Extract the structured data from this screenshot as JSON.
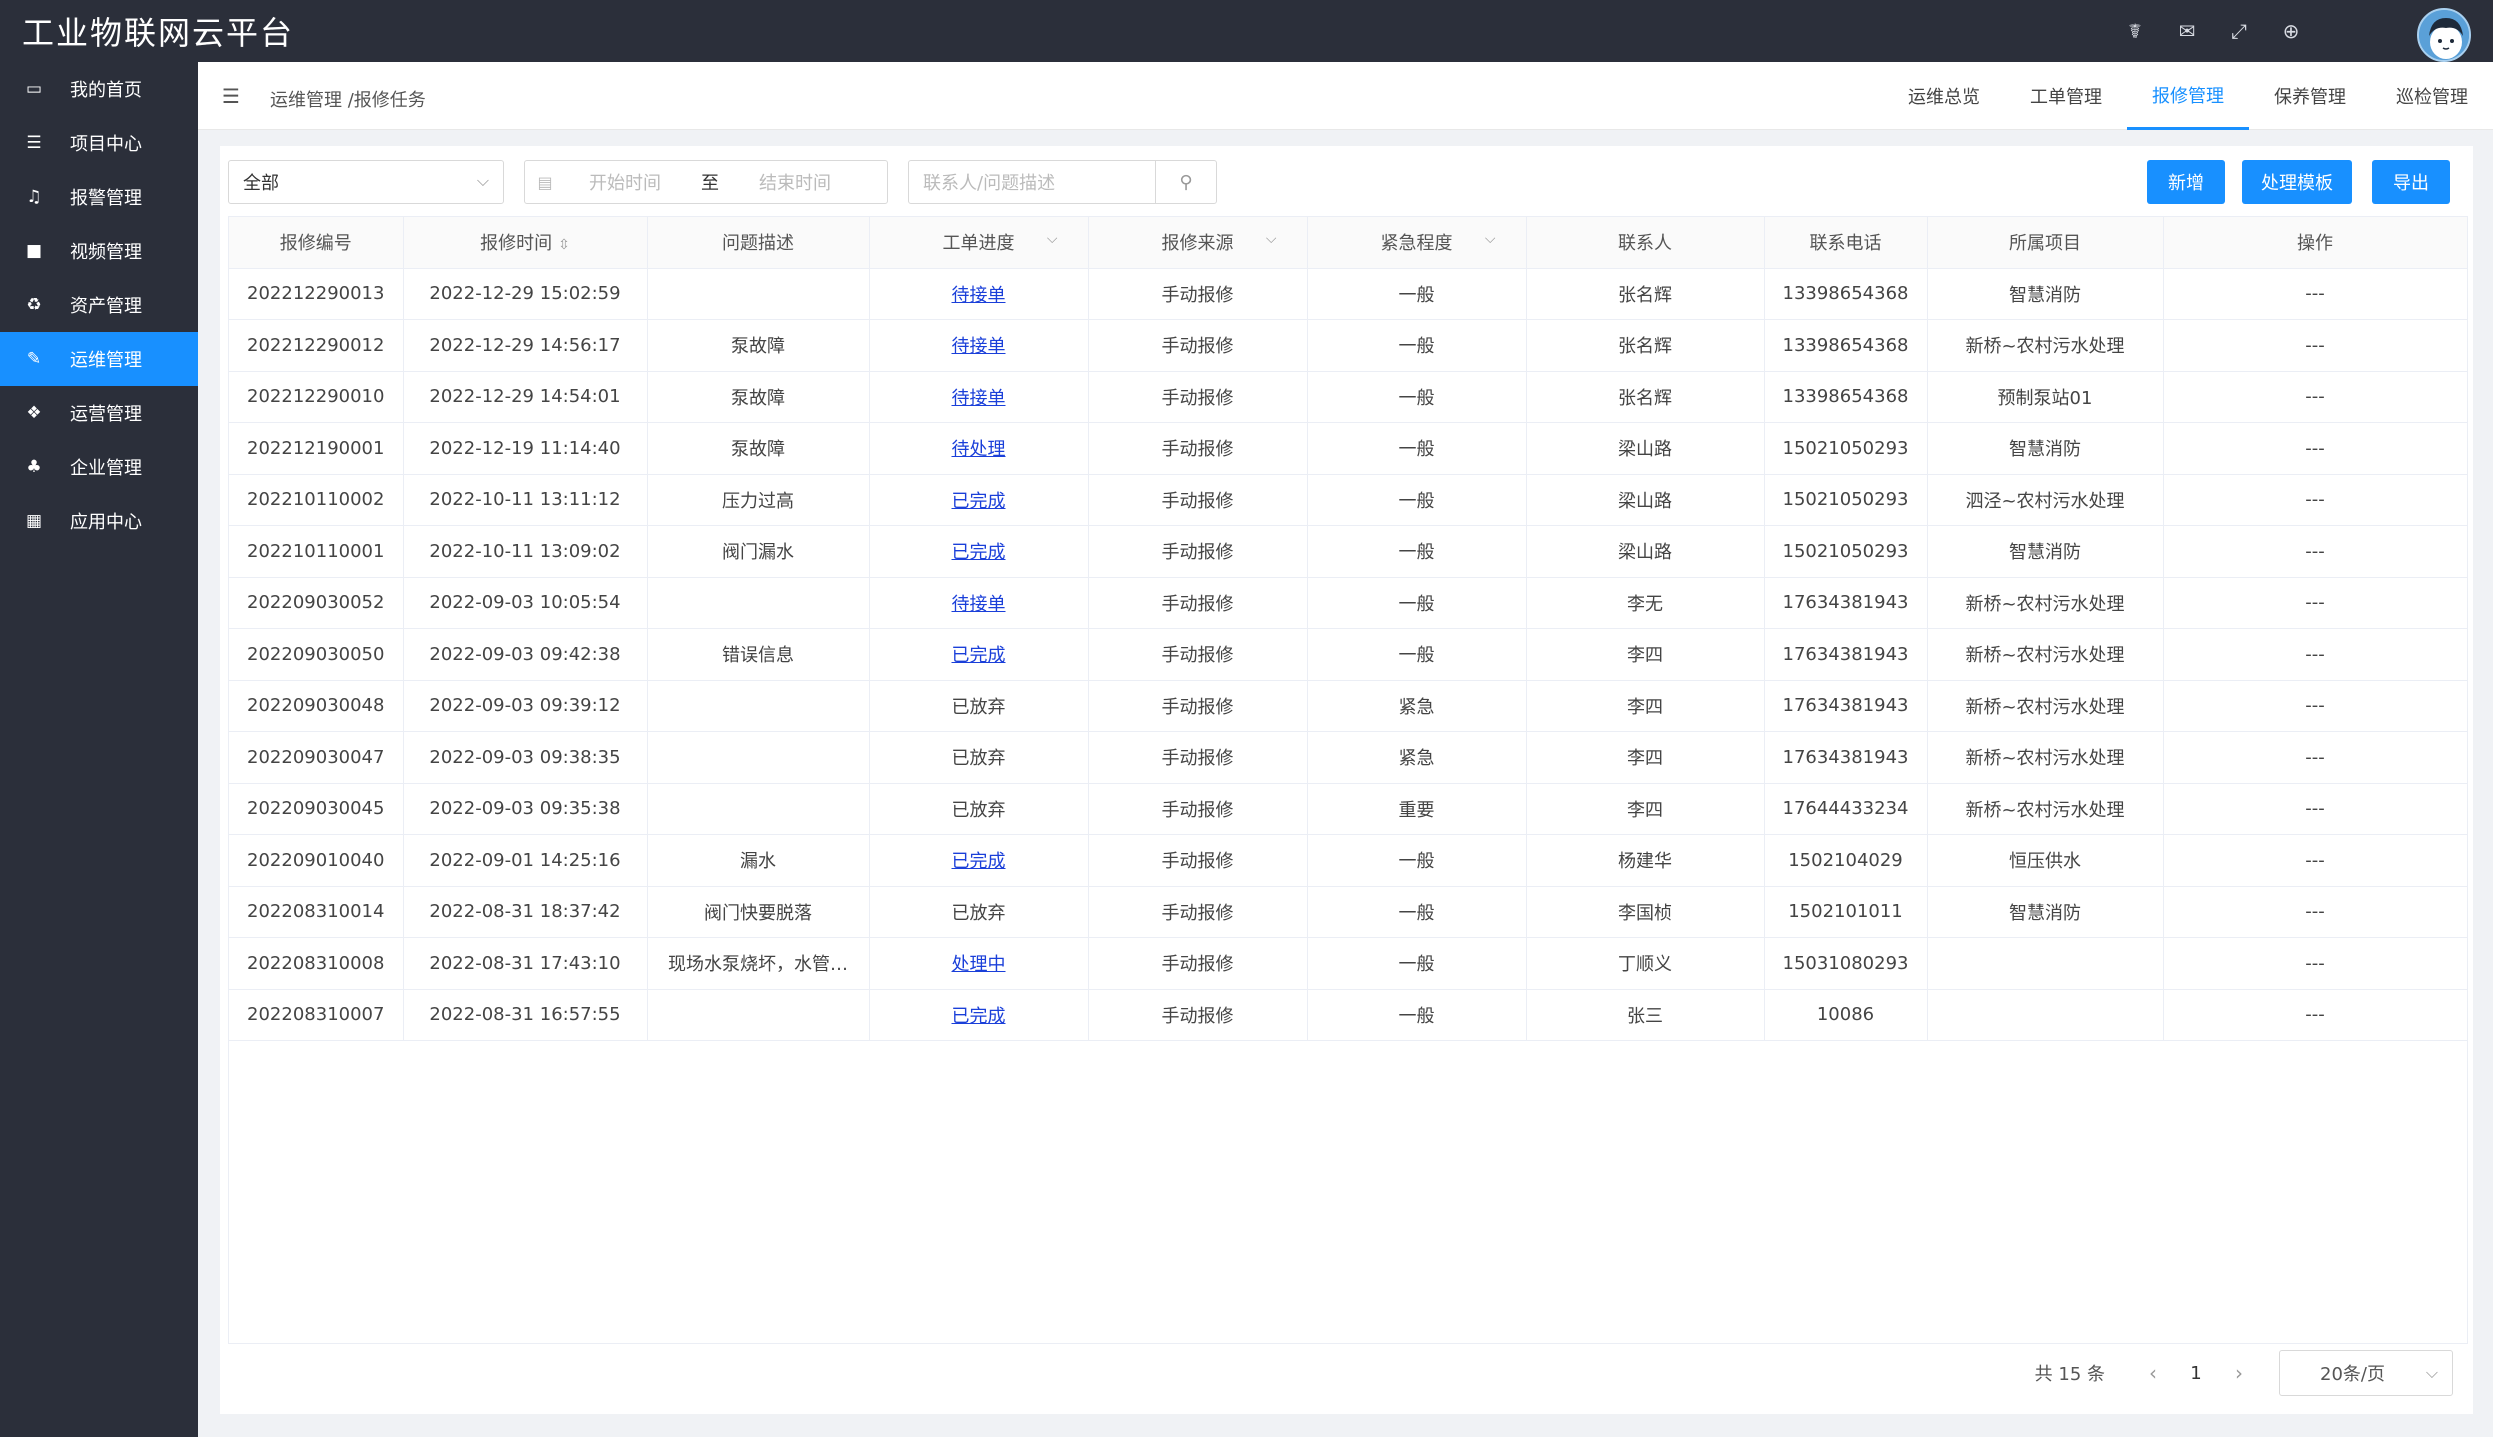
{
  "app": {
    "title": "工业物联网云平台",
    "header_icons": [
      "bug-icon",
      "mail-icon",
      "fullscreen-icon",
      "globe-icon"
    ]
  },
  "sidebar": {
    "items": [
      {
        "label": "我的首页",
        "icon": "laptop-icon",
        "active": false
      },
      {
        "label": "项目中心",
        "icon": "list-icon",
        "active": false
      },
      {
        "label": "报警管理",
        "icon": "bell-icon",
        "active": false
      },
      {
        "label": "视频管理",
        "icon": "video-icon",
        "active": false
      },
      {
        "label": "资产管理",
        "icon": "recycle-icon",
        "active": false
      },
      {
        "label": "运维管理",
        "icon": "wrench-icon",
        "active": true
      },
      {
        "label": "运营管理",
        "icon": "cubes-icon",
        "active": false
      },
      {
        "label": "企业管理",
        "icon": "sitemap-icon",
        "active": false
      },
      {
        "label": "应用中心",
        "icon": "grid-icon",
        "active": false
      }
    ]
  },
  "breadcrumb": "运维管理 /报修任务",
  "tabs": [
    {
      "label": "运维总览",
      "active": false
    },
    {
      "label": "工单管理",
      "active": false
    },
    {
      "label": "报修管理",
      "active": true
    },
    {
      "label": "保养管理",
      "active": false
    },
    {
      "label": "巡检管理",
      "active": false
    }
  ],
  "filters": {
    "status_select": "全部",
    "start_placeholder": "开始时间",
    "range_separator": "至",
    "end_placeholder": "结束时间",
    "search_placeholder": "联系人/问题描述"
  },
  "actions": {
    "add": "新增",
    "template": "处理模板",
    "export": "导出"
  },
  "table": {
    "headers": [
      "报修编号",
      "报修时间",
      "问题描述",
      "工单进度",
      "报修来源",
      "紧急程度",
      "联系人",
      "联系电话",
      "所属项目",
      "操作"
    ],
    "rows": [
      {
        "id": "202212290013",
        "time": "2022-12-29 15:02:59",
        "desc": "",
        "progress": "待接单",
        "link": true,
        "source": "手动报修",
        "urgency": "一般",
        "contact": "张名辉",
        "phone": "13398654368",
        "project": "智慧消防",
        "op": "---"
      },
      {
        "id": "202212290012",
        "time": "2022-12-29 14:56:17",
        "desc": "泵故障",
        "progress": "待接单",
        "link": true,
        "source": "手动报修",
        "urgency": "一般",
        "contact": "张名辉",
        "phone": "13398654368",
        "project": "新桥~农村污水处理",
        "op": "---"
      },
      {
        "id": "202212290010",
        "time": "2022-12-29 14:54:01",
        "desc": "泵故障",
        "progress": "待接单",
        "link": true,
        "source": "手动报修",
        "urgency": "一般",
        "contact": "张名辉",
        "phone": "13398654368",
        "project": "预制泵站01",
        "op": "---"
      },
      {
        "id": "202212190001",
        "time": "2022-12-19 11:14:40",
        "desc": "泵故障",
        "progress": "待处理",
        "link": true,
        "source": "手动报修",
        "urgency": "一般",
        "contact": "梁山路",
        "phone": "15021050293",
        "project": "智慧消防",
        "op": "---"
      },
      {
        "id": "202210110002",
        "time": "2022-10-11 13:11:12",
        "desc": "压力过高",
        "progress": "已完成",
        "link": true,
        "source": "手动报修",
        "urgency": "一般",
        "contact": "梁山路",
        "phone": "15021050293",
        "project": "泗泾~农村污水处理",
        "op": "---"
      },
      {
        "id": "202210110001",
        "time": "2022-10-11 13:09:02",
        "desc": "阀门漏水",
        "progress": "已完成",
        "link": true,
        "source": "手动报修",
        "urgency": "一般",
        "contact": "梁山路",
        "phone": "15021050293",
        "project": "智慧消防",
        "op": "---"
      },
      {
        "id": "202209030052",
        "time": "2022-09-03 10:05:54",
        "desc": "",
        "progress": "待接单",
        "link": true,
        "source": "手动报修",
        "urgency": "一般",
        "contact": "李无",
        "phone": "17634381943",
        "project": "新桥~农村污水处理",
        "op": "---"
      },
      {
        "id": "202209030050",
        "time": "2022-09-03 09:42:38",
        "desc": "错误信息",
        "progress": "已完成",
        "link": true,
        "source": "手动报修",
        "urgency": "一般",
        "contact": "李四",
        "phone": "17634381943",
        "project": "新桥~农村污水处理",
        "op": "---"
      },
      {
        "id": "202209030048",
        "time": "2022-09-03 09:39:12",
        "desc": "",
        "progress": "已放弃",
        "link": false,
        "source": "手动报修",
        "urgency": "紧急",
        "contact": "李四",
        "phone": "17634381943",
        "project": "新桥~农村污水处理",
        "op": "---"
      },
      {
        "id": "202209030047",
        "time": "2022-09-03 09:38:35",
        "desc": "",
        "progress": "已放弃",
        "link": false,
        "source": "手动报修",
        "urgency": "紧急",
        "contact": "李四",
        "phone": "17634381943",
        "project": "新桥~农村污水处理",
        "op": "---"
      },
      {
        "id": "202209030045",
        "time": "2022-09-03 09:35:38",
        "desc": "",
        "progress": "已放弃",
        "link": false,
        "source": "手动报修",
        "urgency": "重要",
        "contact": "李四",
        "phone": "17644433234",
        "project": "新桥~农村污水处理",
        "op": "---"
      },
      {
        "id": "202209010040",
        "time": "2022-09-01 14:25:16",
        "desc": "漏水",
        "progress": "已完成",
        "link": true,
        "source": "手动报修",
        "urgency": "一般",
        "contact": "杨建华",
        "phone": "1502104029",
        "project": "恒压供水",
        "op": "---"
      },
      {
        "id": "202208310014",
        "time": "2022-08-31 18:37:42",
        "desc": "阀门快要脱落",
        "progress": "已放弃",
        "link": false,
        "source": "手动报修",
        "urgency": "一般",
        "contact": "李国桢",
        "phone": "1502101011",
        "project": "智慧消防",
        "op": "---"
      },
      {
        "id": "202208310008",
        "time": "2022-08-31 17:43:10",
        "desc": "现场水泵烧坏，水管…",
        "progress": "处理中",
        "link": true,
        "source": "手动报修",
        "urgency": "一般",
        "contact": "丁顺义",
        "phone": "15031080293",
        "project": "",
        "op": "---"
      },
      {
        "id": "202208310007",
        "time": "2022-08-31 16:57:55",
        "desc": "",
        "progress": "已完成",
        "link": true,
        "source": "手动报修",
        "urgency": "一般",
        "contact": "张三",
        "phone": "10086",
        "project": "",
        "op": "---"
      }
    ]
  },
  "pagination": {
    "total": "共 15 条",
    "page": "1",
    "page_size": "20条/页"
  },
  "colors": {
    "sidebar_bg": "#2b2f3a",
    "accent": "#1890ff",
    "link": "#1a3fd9"
  }
}
